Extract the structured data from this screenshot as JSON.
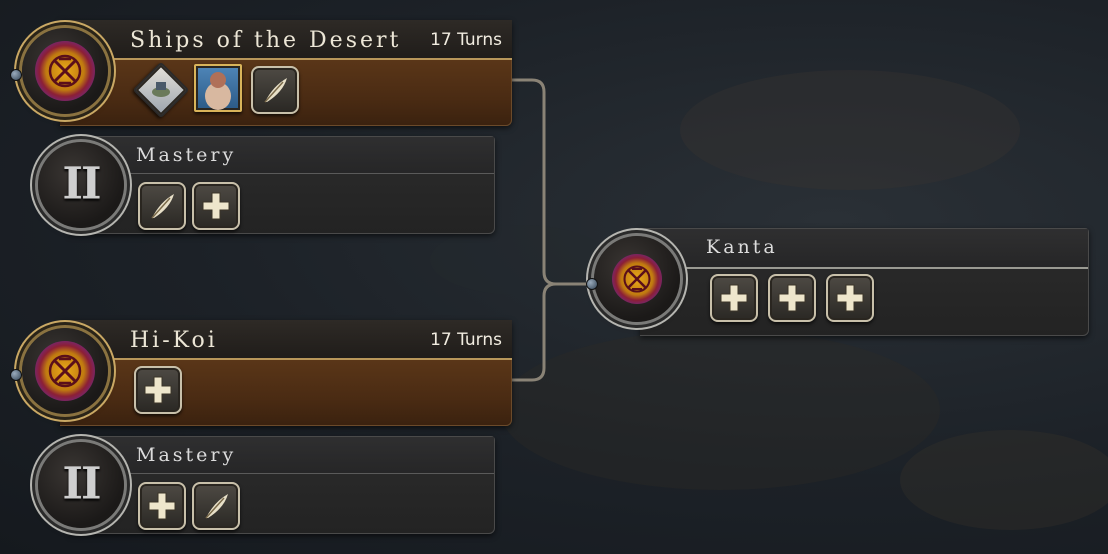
{
  "cards": {
    "ships": {
      "title": "Ships of the Desert",
      "turns": "17 Turns"
    },
    "mastery1": {
      "title": "Mastery",
      "roman": "II"
    },
    "hikoi": {
      "title": "Hi-Koi",
      "turns": "17 Turns"
    },
    "mastery2": {
      "title": "Mastery",
      "roman": "II"
    },
    "kanta": {
      "title": "Kanta"
    }
  },
  "icons": {
    "ships": [
      "unit-diamond-icon",
      "portrait-icon",
      "quill-icon"
    ],
    "mastery1": [
      "quill-icon",
      "plus-icon"
    ],
    "hikoi": [
      "plus-icon"
    ],
    "mastery2": [
      "plus-icon",
      "quill-icon"
    ],
    "kanta": [
      "plus-icon",
      "plus-icon",
      "plus-icon"
    ]
  },
  "colors": {
    "gold_trim": "#c9a864",
    "panel_brown": "#4a2b13",
    "emblem_gold": "#e8a91a",
    "emblem_purple": "#6a2a8a"
  }
}
